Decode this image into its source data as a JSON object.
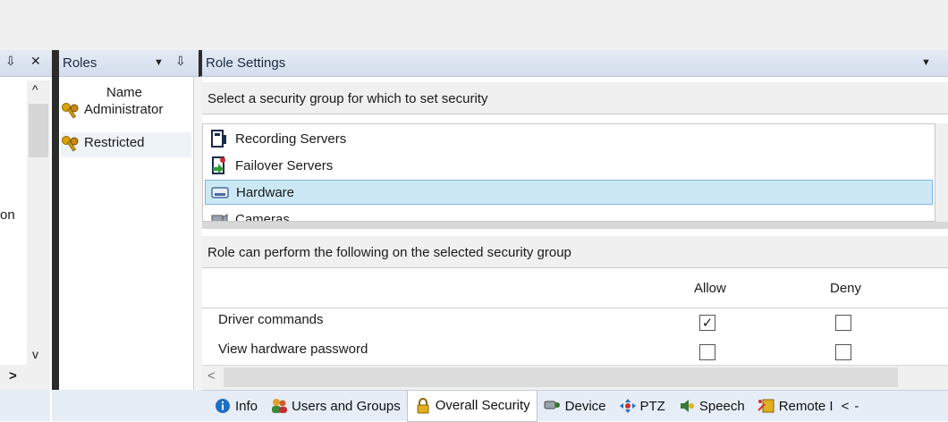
{
  "left_pane": {
    "pin_glyph": "⇩",
    "close_glyph": "✕",
    "partial_label": "on",
    "scroll_up": "^",
    "scroll_down": "v",
    "scroll_right": ">"
  },
  "roles_pane": {
    "title": "Roles",
    "dropdown_glyph": "▼",
    "pin_glyph": "⇩",
    "column_header": "Name",
    "items": [
      {
        "label": "Administrator"
      },
      {
        "label": "Restricted"
      }
    ]
  },
  "role_settings": {
    "title": "Role Settings",
    "dropdown_glyph": "▼",
    "select_prompt": "Select a security group for which to set security",
    "security_groups": [
      {
        "label": "Recording Servers",
        "icon": "recording-server-icon"
      },
      {
        "label": "Failover Servers",
        "icon": "failover-server-icon"
      },
      {
        "label": "Hardware",
        "icon": "hardware-icon"
      },
      {
        "label": "Cameras",
        "icon": "camera-icon"
      }
    ],
    "selected_group": "Hardware",
    "perform_prompt": "Role can perform the following on the selected security group",
    "columns": {
      "allow": "Allow",
      "deny": "Deny"
    },
    "permissions": [
      {
        "label": "Driver commands",
        "allow": true,
        "deny": false
      },
      {
        "label": "View hardware password",
        "allow": false,
        "deny": false
      }
    ],
    "check_glyph": "✓",
    "scroll_left": "<",
    "scroll_right": ">"
  },
  "tabs": [
    {
      "label": "Info",
      "icon": "info-icon"
    },
    {
      "label": "Users and Groups",
      "icon": "users-icon"
    },
    {
      "label": "Overall Security",
      "icon": "lock-icon",
      "active": true
    },
    {
      "label": "Device",
      "icon": "device-icon"
    },
    {
      "label": "PTZ",
      "icon": "ptz-icon"
    },
    {
      "label": "Speech",
      "icon": "speech-icon"
    },
    {
      "label": "Remote I",
      "icon": "remote-icon"
    }
  ],
  "tab_nav": {
    "prev": "<",
    "next": "-"
  },
  "colors": {
    "selection": "#cde8f5",
    "header": "#d3ddec",
    "tabbar": "#e6edf7"
  }
}
